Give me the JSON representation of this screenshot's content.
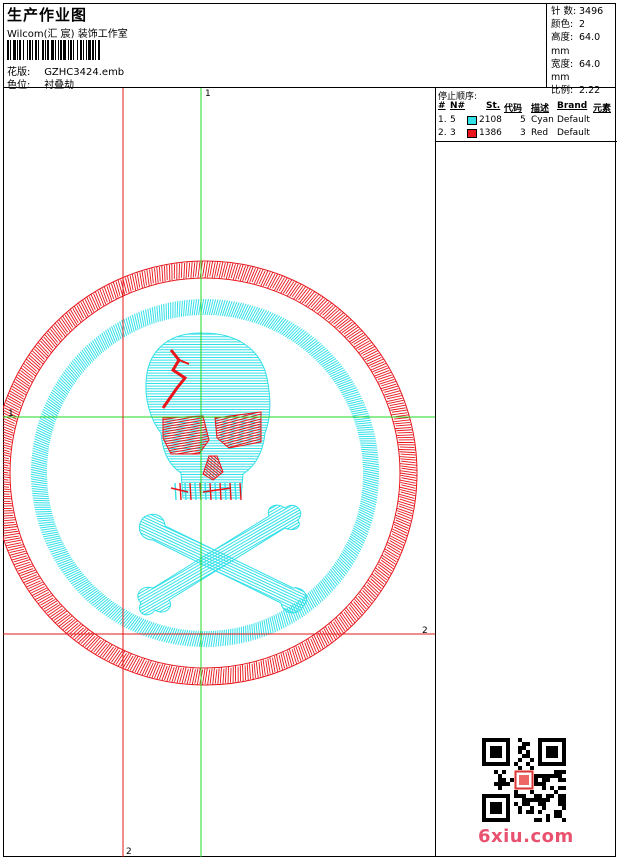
{
  "header": {
    "title": "生产作业图",
    "company": "Wilcom(汇 宸) 装饰工作室",
    "file_label": "花版:",
    "file_name": "GZHC3424.emb",
    "color_label": "色位:",
    "color_value": "衬叠劫"
  },
  "stats": [
    {
      "key": "针 数:",
      "value": "3496"
    },
    {
      "key": "颜色:",
      "value": "2"
    },
    {
      "key": "高度:",
      "value": "64.0 mm"
    },
    {
      "key": "宽度:",
      "value": "64.0 mm"
    },
    {
      "key": "比例:",
      "value": "2.22"
    }
  ],
  "color_table": {
    "stop_title": "停止顺序:",
    "headers": [
      "#",
      "N#",
      "St.",
      "代码",
      "描述",
      "Brand",
      "元素"
    ],
    "rows": [
      {
        "num": "1.",
        "n": "5",
        "swatch": "#33e0e8",
        "stitches": "2108",
        "code": "5",
        "desc": "Cyan",
        "brand": "Default"
      },
      {
        "num": "2.",
        "n": "3",
        "swatch": "#e8151b",
        "stitches": "1386",
        "code": "3",
        "desc": "Red",
        "brand": "Default"
      }
    ]
  },
  "guides": {
    "green_top_label": "1",
    "green_left_label": "1",
    "red_right_label": "2",
    "red_bottom_label": "2"
  },
  "colors": {
    "cyan": "#33e0e8",
    "red": "#e8151b",
    "green_guide": "#1fd81f",
    "red_guide": "#e01818",
    "logo": "#e8526f"
  },
  "footer": {
    "logo_text": "6xiu.com",
    "qr_icon": "qr-code-icon"
  }
}
